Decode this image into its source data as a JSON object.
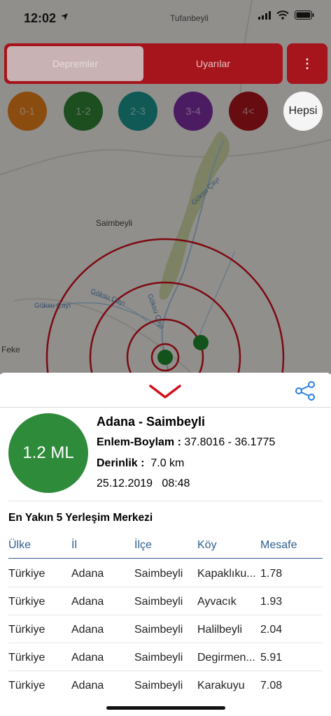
{
  "status_bar": {
    "time": "12:02",
    "location_arrow": "location-arrow-icon",
    "carrier": "Tufanbeyli",
    "icons": [
      "signal-icon",
      "wifi-icon",
      "battery-icon"
    ]
  },
  "map": {
    "labels": {
      "town_1": "Saimbeyli",
      "town_2": "Feke",
      "river_1": "Göksu Çayı",
      "river_2": "Göksu Çayı",
      "river_3": "Göksu Çayı",
      "river_4": "Göksu Çayı"
    },
    "epicenter_color": "#1f8a2e"
  },
  "tabs": {
    "earthquakes": "Depremler",
    "alerts": "Uyarılar"
  },
  "menu_button": "⋮",
  "filters": [
    {
      "label": "0-1",
      "color": "#e07a1a"
    },
    {
      "label": "1-2",
      "color": "#2e7d32"
    },
    {
      "label": "2-3",
      "color": "#1a8f88"
    },
    {
      "label": "3-4",
      "color": "#7b2da0"
    },
    {
      "label": "4<",
      "color": "#a6141c"
    },
    {
      "label": "Hepsi",
      "color": "#f5f5f5"
    }
  ],
  "quake": {
    "magnitude": "1.2 ML",
    "title": "Adana - Saimbeyli",
    "coords_label": "Enlem-Boylam :",
    "coords_value": "37.8016 - 36.1775",
    "depth_label": "Derinlik :",
    "depth_value": "7.0 km",
    "datetime": "25.12.2019   08:48"
  },
  "nearest": {
    "title": "En Yakın 5 Yerleşim Merkezi",
    "headers": [
      "Ülke",
      "İl",
      "İlçe",
      "Köy",
      "Mesafe"
    ],
    "rows": [
      [
        "Türkiye",
        "Adana",
        "Saimbeyli",
        "Kapaklıku...",
        "1.78"
      ],
      [
        "Türkiye",
        "Adana",
        "Saimbeyli",
        "Ayvacık",
        "1.93"
      ],
      [
        "Türkiye",
        "Adana",
        "Saimbeyli",
        "Halilbeyli",
        "2.04"
      ],
      [
        "Türkiye",
        "Adana",
        "Saimbeyli",
        "Degirmen...",
        "5.91"
      ],
      [
        "Türkiye",
        "Adana",
        "Saimbeyli",
        "Karakuyu",
        "7.08"
      ]
    ]
  },
  "colors": {
    "accent": "#a6141c",
    "magnitude": "#2e8b3a",
    "header_text": "#2f5f8f"
  }
}
